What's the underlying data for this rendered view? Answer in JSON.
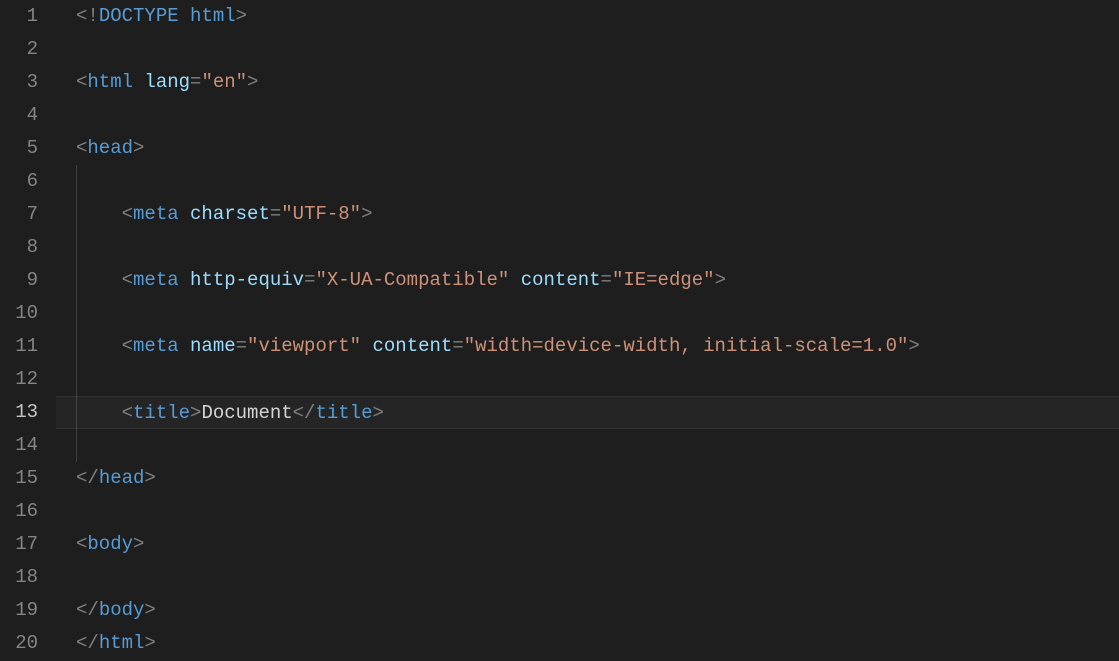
{
  "editor": {
    "activeLine": 13,
    "lines": [
      {
        "num": 1,
        "indent": 0,
        "tokens": [
          {
            "t": "punct",
            "v": "<!"
          },
          {
            "t": "doctype",
            "v": "DOCTYPE"
          },
          {
            "t": "text",
            "v": " "
          },
          {
            "t": "doctype",
            "v": "html"
          },
          {
            "t": "punct",
            "v": ">"
          }
        ]
      },
      {
        "num": 2,
        "indent": 0,
        "tokens": []
      },
      {
        "num": 3,
        "indent": 0,
        "tokens": [
          {
            "t": "punct",
            "v": "<"
          },
          {
            "t": "tag",
            "v": "html"
          },
          {
            "t": "text",
            "v": " "
          },
          {
            "t": "attr",
            "v": "lang"
          },
          {
            "t": "punct",
            "v": "="
          },
          {
            "t": "str",
            "v": "\"en\""
          },
          {
            "t": "punct",
            "v": ">"
          }
        ]
      },
      {
        "num": 4,
        "indent": 0,
        "tokens": []
      },
      {
        "num": 5,
        "indent": 0,
        "tokens": [
          {
            "t": "punct",
            "v": "<"
          },
          {
            "t": "tag",
            "v": "head"
          },
          {
            "t": "punct",
            "v": ">"
          }
        ]
      },
      {
        "num": 6,
        "indent": 0,
        "tokens": []
      },
      {
        "num": 7,
        "indent": 1,
        "tokens": [
          {
            "t": "punct",
            "v": "<"
          },
          {
            "t": "tag",
            "v": "meta"
          },
          {
            "t": "text",
            "v": " "
          },
          {
            "t": "attr",
            "v": "charset"
          },
          {
            "t": "punct",
            "v": "="
          },
          {
            "t": "str",
            "v": "\"UTF-8\""
          },
          {
            "t": "punct",
            "v": ">"
          }
        ]
      },
      {
        "num": 8,
        "indent": 0,
        "tokens": []
      },
      {
        "num": 9,
        "indent": 1,
        "tokens": [
          {
            "t": "punct",
            "v": "<"
          },
          {
            "t": "tag",
            "v": "meta"
          },
          {
            "t": "text",
            "v": " "
          },
          {
            "t": "attr",
            "v": "http-equiv"
          },
          {
            "t": "punct",
            "v": "="
          },
          {
            "t": "str",
            "v": "\"X-UA-Compatible\""
          },
          {
            "t": "text",
            "v": " "
          },
          {
            "t": "attr",
            "v": "content"
          },
          {
            "t": "punct",
            "v": "="
          },
          {
            "t": "str",
            "v": "\"IE=edge\""
          },
          {
            "t": "punct",
            "v": ">"
          }
        ]
      },
      {
        "num": 10,
        "indent": 0,
        "tokens": []
      },
      {
        "num": 11,
        "indent": 1,
        "tokens": [
          {
            "t": "punct",
            "v": "<"
          },
          {
            "t": "tag",
            "v": "meta"
          },
          {
            "t": "text",
            "v": " "
          },
          {
            "t": "attr",
            "v": "name"
          },
          {
            "t": "punct",
            "v": "="
          },
          {
            "t": "str",
            "v": "\"viewport\""
          },
          {
            "t": "text",
            "v": " "
          },
          {
            "t": "attr",
            "v": "content"
          },
          {
            "t": "punct",
            "v": "="
          },
          {
            "t": "str",
            "v": "\"width=device-width, initial-scale=1.0\""
          },
          {
            "t": "punct",
            "v": ">"
          }
        ]
      },
      {
        "num": 12,
        "indent": 0,
        "tokens": []
      },
      {
        "num": 13,
        "indent": 1,
        "tokens": [
          {
            "t": "punct",
            "v": "<"
          },
          {
            "t": "tag",
            "v": "title"
          },
          {
            "t": "punct",
            "v": ">"
          },
          {
            "t": "text",
            "v": "Document"
          },
          {
            "t": "punct",
            "v": "</"
          },
          {
            "t": "tag",
            "v": "title"
          },
          {
            "t": "punct",
            "v": ">"
          }
        ]
      },
      {
        "num": 14,
        "indent": 0,
        "tokens": []
      },
      {
        "num": 15,
        "indent": 0,
        "tokens": [
          {
            "t": "punct",
            "v": "</"
          },
          {
            "t": "tag",
            "v": "head"
          },
          {
            "t": "punct",
            "v": ">"
          }
        ]
      },
      {
        "num": 16,
        "indent": 0,
        "tokens": []
      },
      {
        "num": 17,
        "indent": 0,
        "tokens": [
          {
            "t": "punct",
            "v": "<"
          },
          {
            "t": "tag",
            "v": "body"
          },
          {
            "t": "punct",
            "v": ">"
          }
        ]
      },
      {
        "num": 18,
        "indent": 0,
        "tokens": []
      },
      {
        "num": 19,
        "indent": 0,
        "tokens": [
          {
            "t": "punct",
            "v": "</"
          },
          {
            "t": "tag",
            "v": "body"
          },
          {
            "t": "punct",
            "v": ">"
          }
        ]
      },
      {
        "num": 20,
        "indent": 0,
        "tokens": [
          {
            "t": "punct",
            "v": "</"
          },
          {
            "t": "tag",
            "v": "html"
          },
          {
            "t": "punct",
            "v": ">"
          }
        ]
      }
    ]
  }
}
